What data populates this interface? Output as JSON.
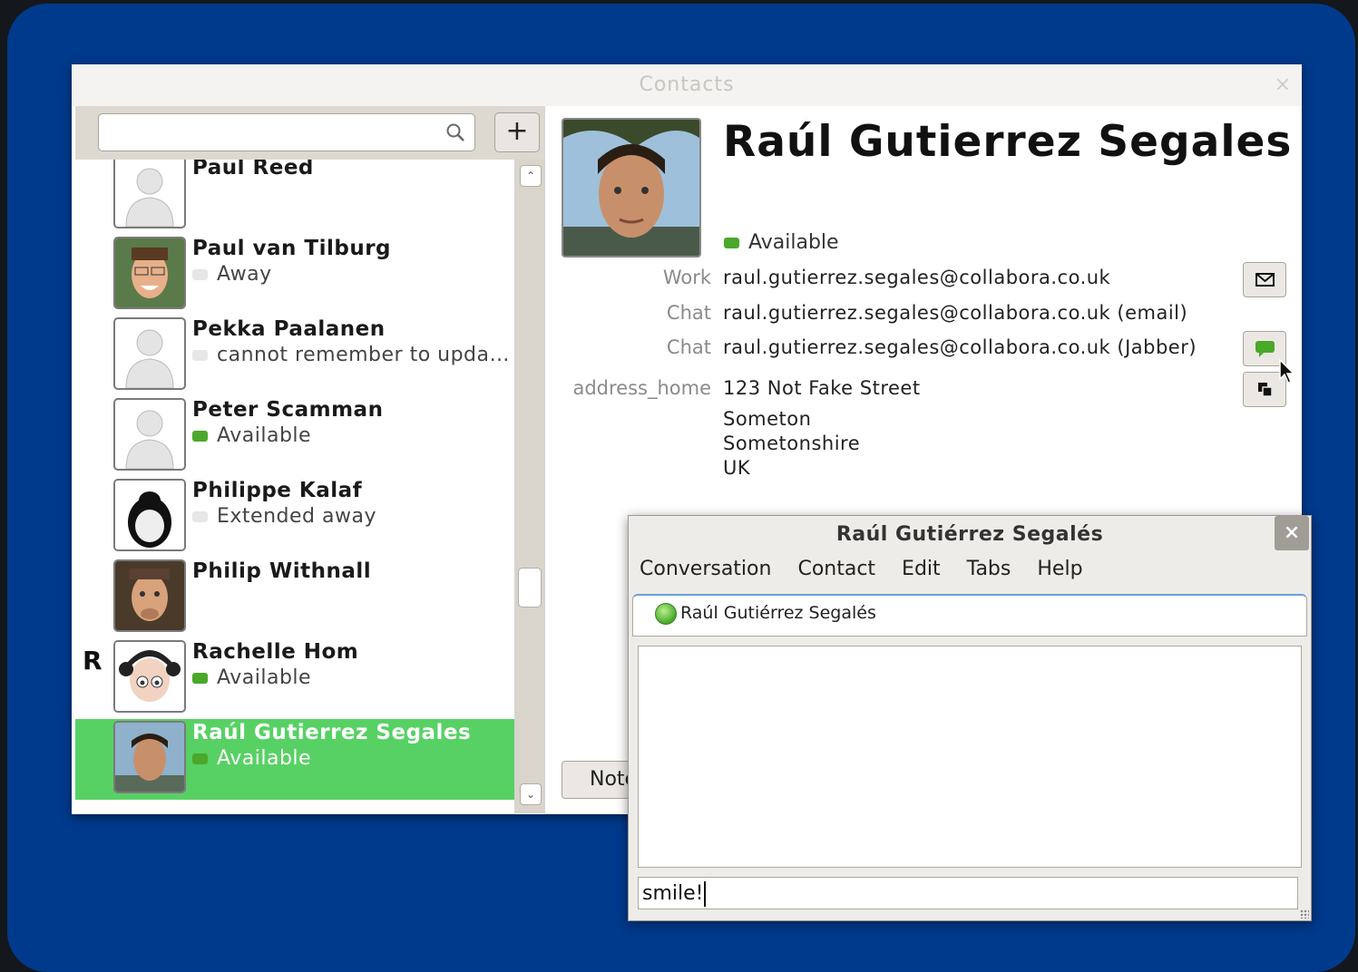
{
  "contacts_window": {
    "title": "Contacts",
    "close_glyph": "×",
    "add_glyph": "+",
    "search_placeholder": "",
    "section_letter": "R",
    "items": [
      {
        "name": "Paul Reed",
        "status": "",
        "presence": "none",
        "avatar": "default-avatar"
      },
      {
        "name": "Paul van Tilburg",
        "status": "Away",
        "presence": "grey",
        "avatar": "photo"
      },
      {
        "name": "Pekka Paalanen",
        "status": "cannot remember to upda…",
        "presence": "grey",
        "avatar": "default-avatar"
      },
      {
        "name": "Peter Scamman",
        "status": "Available",
        "presence": "green",
        "avatar": "default-avatar"
      },
      {
        "name": "Philippe Kalaf",
        "status": "Extended away",
        "presence": "grey",
        "avatar": "penguin"
      },
      {
        "name": "Philip Withnall",
        "status": "",
        "presence": "none",
        "avatar": "photo"
      },
      {
        "name": "Rachelle Hom",
        "status": "Available",
        "presence": "green",
        "avatar": "cartoon"
      },
      {
        "name": "Raúl Gutierrez Segales",
        "status": "Available",
        "presence": "green",
        "avatar": "photo",
        "selected": true
      }
    ]
  },
  "details": {
    "name": "Raúl Gutierrez Segales",
    "status": "Available",
    "fields": [
      {
        "label": "Work",
        "value": "raul.gutierrez.segales@collabora.co.uk"
      },
      {
        "label": "Chat",
        "value": "raul.gutierrez.segales@collabora.co.uk (email)"
      },
      {
        "label": "Chat",
        "value": "raul.gutierrez.segales@collabora.co.uk (Jabber)"
      }
    ],
    "address_label": "address_home",
    "address_lines": [
      "123 Not Fake Street",
      "Someton",
      "Sometonshire",
      "UK"
    ],
    "notes_label": "Note"
  },
  "chat_window": {
    "title": "Raúl Gutiérrez Segalés",
    "close_glyph": "×",
    "menu": [
      "Conversation",
      "Contact",
      "Edit",
      "Tabs",
      "Help"
    ],
    "tab_label": "Raúl Gutiérrez Segalés",
    "input_value": "smile!"
  },
  "colors": {
    "desktop": "#003a8c",
    "selection": "#57d164",
    "available": "#4aa82a"
  }
}
